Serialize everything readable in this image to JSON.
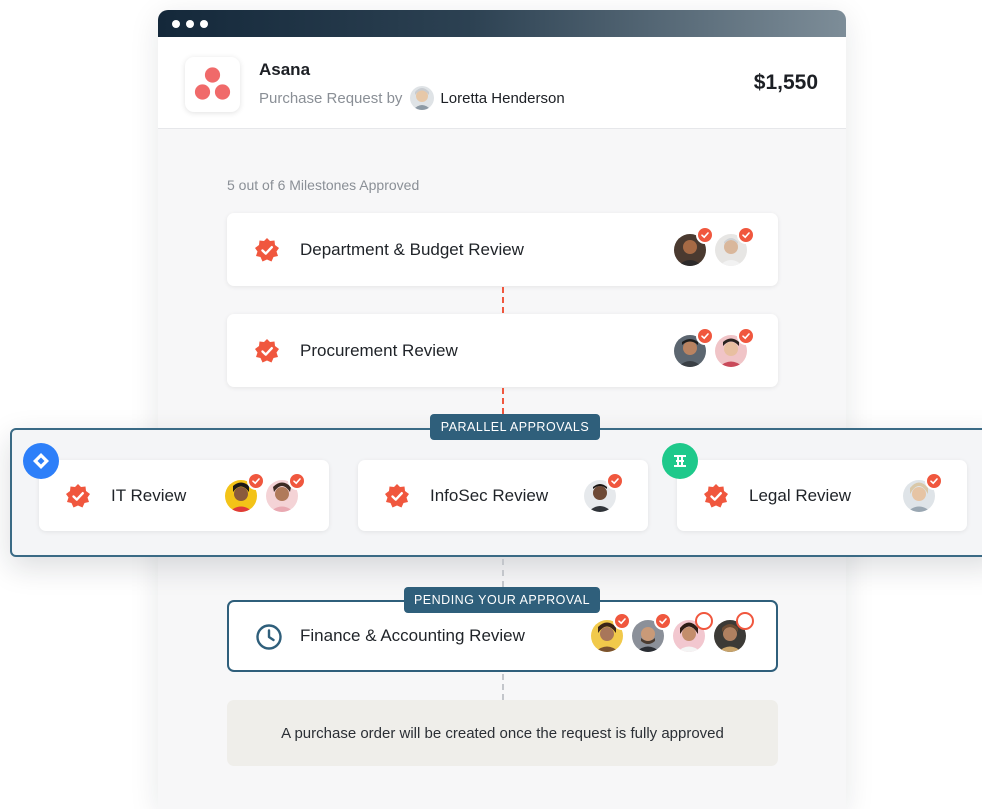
{
  "window": {
    "dots": 3
  },
  "header": {
    "vendor": "Asana",
    "subtitle_prefix": "Purchase Request by",
    "requester": "Loretta Henderson",
    "amount": "$1,550"
  },
  "progress_text": "5 out of 6 Milestones Approved",
  "milestones": [
    {
      "label": "Department & Budget Review",
      "status": "approved",
      "approvers": [
        {
          "status": "approved"
        },
        {
          "status": "approved"
        }
      ]
    },
    {
      "label": "Procurement Review",
      "status": "approved",
      "approvers": [
        {
          "status": "approved"
        },
        {
          "status": "approved"
        }
      ]
    }
  ],
  "parallel": {
    "label": "PARALLEL APPROVALS",
    "reviews": [
      {
        "label": "IT Review",
        "integration": "jira-icon",
        "approvers": [
          {
            "status": "approved"
          },
          {
            "status": "approved"
          }
        ]
      },
      {
        "label": "InfoSec Review",
        "integration": "",
        "approvers": [
          {
            "status": "approved"
          }
        ]
      },
      {
        "label": "Legal Review",
        "integration": "ironclad-icon",
        "approvers": [
          {
            "status": "approved"
          }
        ]
      }
    ]
  },
  "pending": {
    "label": "PENDING YOUR APPROVAL",
    "review": "Finance & Accounting Review",
    "approvers": [
      {
        "status": "approved"
      },
      {
        "status": "approved"
      },
      {
        "status": "pending"
      },
      {
        "status": "pending"
      }
    ]
  },
  "note": "A purchase order will be created once the request is fully approved",
  "colors": {
    "accent": "#f0573e",
    "navy": "#2f5f7b",
    "jira": "#2d7ff9",
    "ironclad": "#1ec98b",
    "asana": "#f06a6a"
  }
}
